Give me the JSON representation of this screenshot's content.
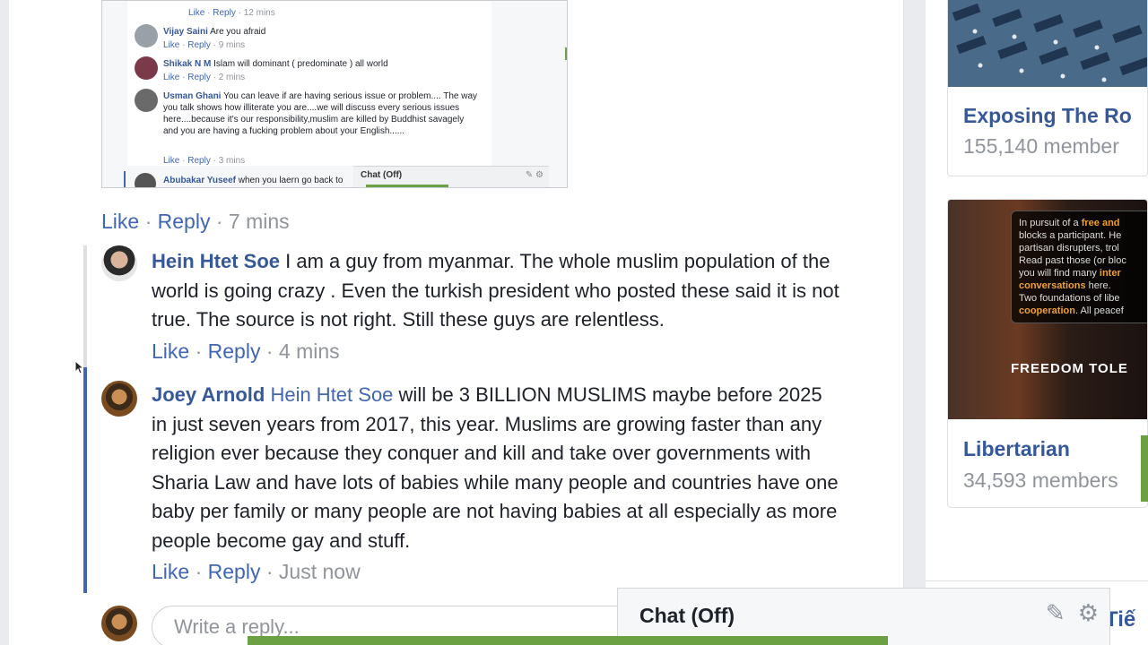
{
  "embedded_screenshot": {
    "rows": [
      {
        "name": "",
        "text": "",
        "meta": [
          "Like",
          "Reply",
          "12 mins"
        ]
      },
      {
        "name": "Vijay Saini",
        "text": "Are you afraid",
        "meta": [
          "Like",
          "Reply",
          "9 mins"
        ]
      },
      {
        "name": "Shikak N M",
        "text": "Islam will dominant ( predominate ) all world",
        "meta": [
          "Like",
          "Reply",
          "2 mins"
        ]
      },
      {
        "name": "Usman Ghani",
        "text": "You can leave if are having serious issue or problem.... The way you talk shows how illiterate you are....we will discuss every serious issues here....because it's our responsibility,muslim are killed by Buddhist savagely and you are having a fucking problem about your English......",
        "meta": [
          "Like",
          "Reply",
          "3 mins"
        ]
      },
      {
        "name": "Abubakar Yuseef",
        "text": "when you laern go back to",
        "meta": []
      }
    ],
    "chat_label": "Chat (Off)"
  },
  "parent_actions": {
    "like": "Like",
    "reply": "Reply",
    "time": "7 mins"
  },
  "comments": [
    {
      "author": "Hein Htet Soe",
      "mention": "",
      "text": "I am a guy from myanmar. The whole muslim population of the world is going crazy . Even the turkish president who posted these said it is not true. The source is not right. Still these guys are relentless.",
      "like": "Like",
      "reply": "Reply",
      "time": "4 mins"
    },
    {
      "author": "Joey Arnold",
      "mention": "Hein Htet Soe",
      "text": "will be 3 BILLION MUSLIMS maybe before 2025 in just seven years from 2017, this year. Muslims are growing faster than any religion ever because they conquer and kill and take over governments with Sharia Law and have lots of babies while many people and countries have one baby per family or many people are not having babies at all especially as more people become gay and stuff.",
      "like": "Like",
      "reply": "Reply",
      "time": "Just now"
    }
  ],
  "reply_input": {
    "placeholder": "Write a reply..."
  },
  "chat": {
    "title": "Chat (Off)",
    "icons": [
      "compose-icon",
      "gear-icon"
    ]
  },
  "sidebar": {
    "groups": [
      {
        "title": "Exposing The Ro",
        "members": "155,140 member"
      },
      {
        "title": "Libertarian",
        "members": "34,593 members"
      }
    ],
    "promo": {
      "line1": "In pursuit of a",
      "hl1": "free and",
      "line2": "blocks a participant. He",
      "line3": "partisan disrupters, trol",
      "line4": "Read past those (or bloc",
      "line5": "you will find many",
      "hl2": "inter",
      "hl3": "conversations",
      "line6": "here.",
      "line7": "Two foundations of libe",
      "hl4": "cooperation",
      "line8": ". All peacef",
      "banner": "FREEDOM  TOLE"
    },
    "bottom_text": "Tiế"
  }
}
